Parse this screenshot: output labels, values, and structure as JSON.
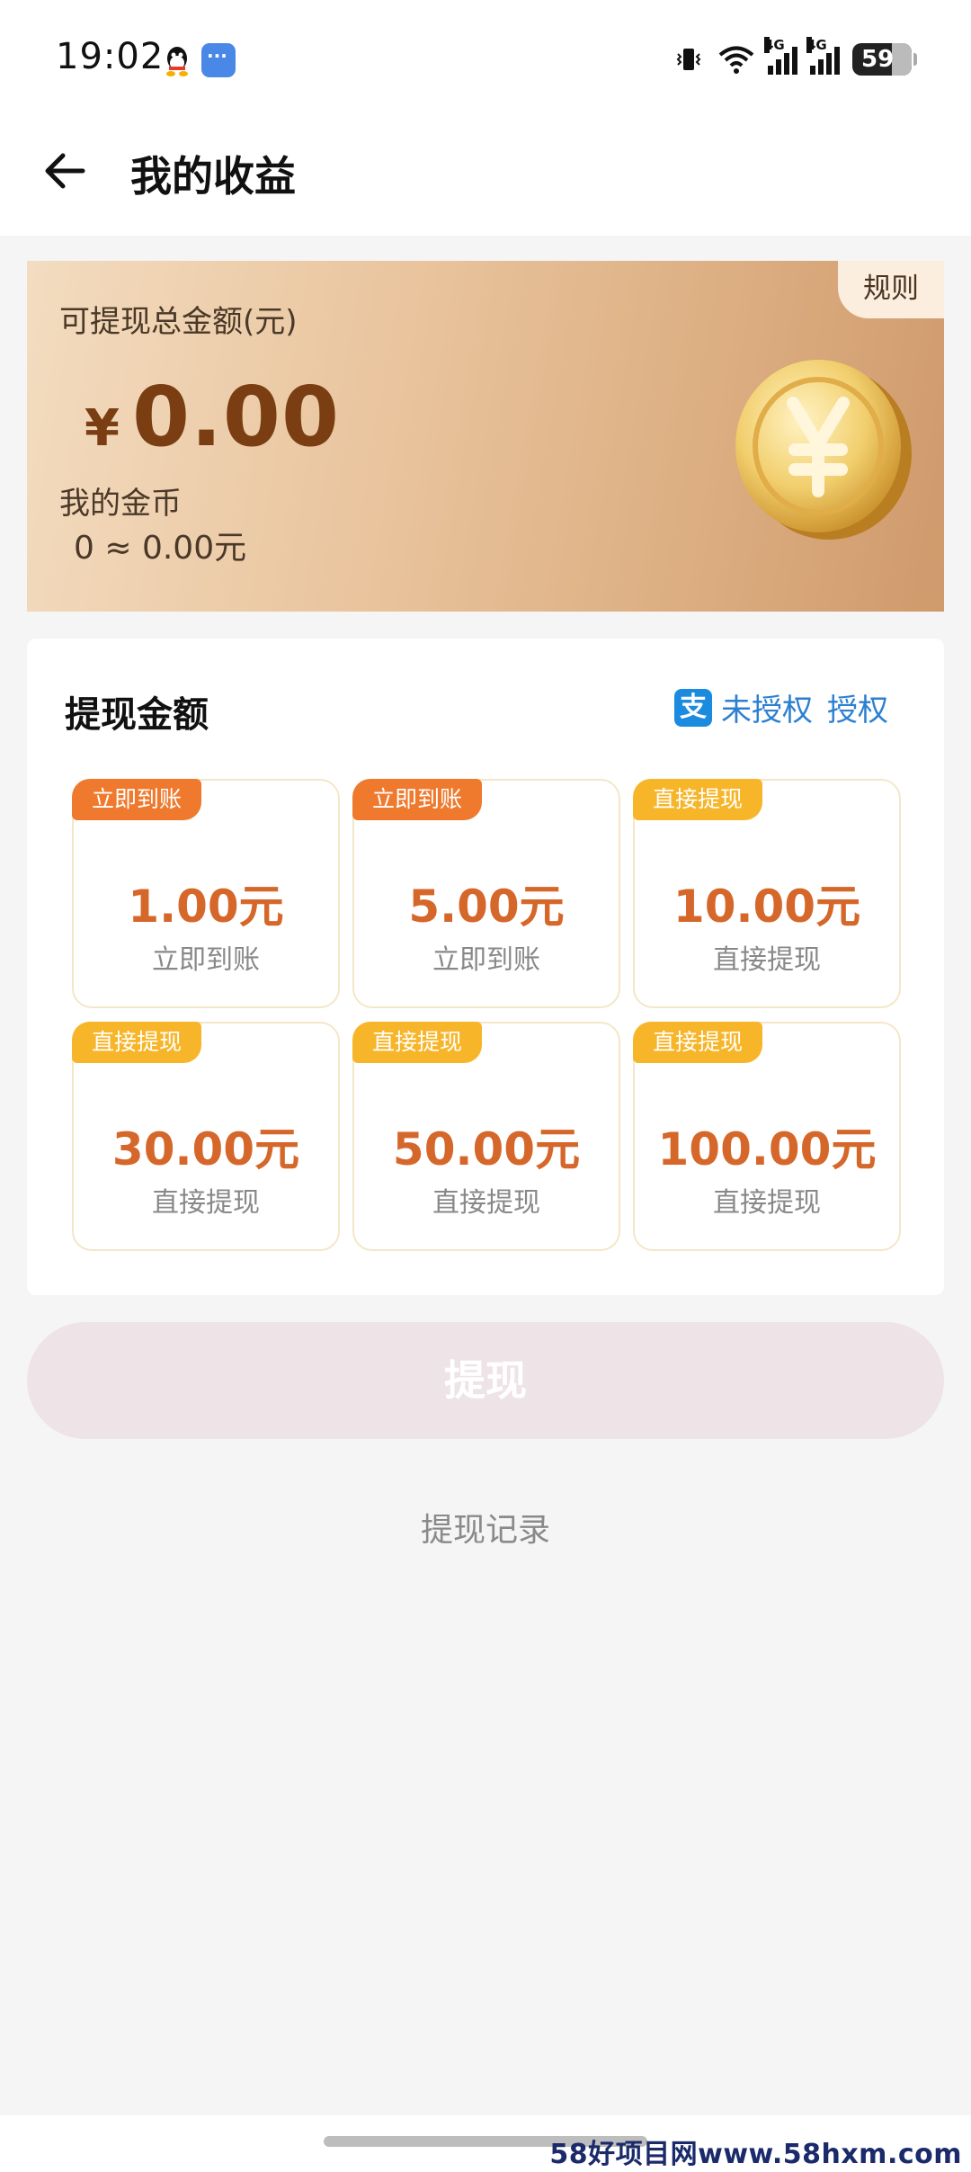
{
  "status_bar": {
    "time": "19:02",
    "app_icons": [
      "qq-icon",
      "message-icon"
    ],
    "network_label_1": "4G",
    "network_label_2": "4G",
    "battery": "59"
  },
  "header": {
    "title": "我的收益"
  },
  "balance": {
    "rules_label": "规则",
    "label": "可提现总金额(元)",
    "currency_symbol": "¥",
    "amount": "0.00",
    "coin_label": "我的金币",
    "coin_value": "0 ≈ 0.00元"
  },
  "withdraw": {
    "title": "提现金额",
    "auth_status": "未授权",
    "auth_action": "授权",
    "options": [
      {
        "badge": "立即到账",
        "amount": "1.00元",
        "sub": "立即到账"
      },
      {
        "badge": "立即到账",
        "amount": "5.00元",
        "sub": "立即到账"
      },
      {
        "badge": "直接提现",
        "amount": "10.00元",
        "sub": "直接提现"
      },
      {
        "badge": "直接提现",
        "amount": "30.00元",
        "sub": "直接提现"
      },
      {
        "badge": "直接提现",
        "amount": "50.00元",
        "sub": "直接提现"
      },
      {
        "badge": "直接提现",
        "amount": "100.00元",
        "sub": "直接提现"
      }
    ],
    "button_label": "提现",
    "records_label": "提现记录"
  },
  "watermark": "58好项目网www.58hxm.com",
  "colors": {
    "accent_orange": "#d6672a",
    "badge_instant": "#ef7a2e",
    "badge_direct": "#f7b52a",
    "alipay_blue": "#2c7fd1"
  }
}
